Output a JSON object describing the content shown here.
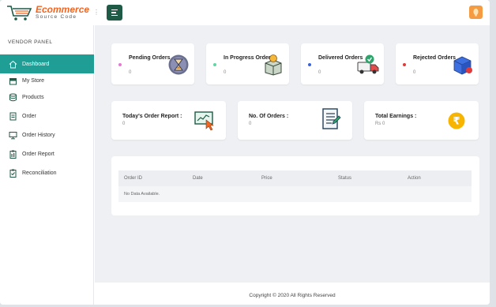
{
  "app": {
    "logo_title": "Ecommerce",
    "logo_subtitle": "Source Code",
    "dots": "⋮"
  },
  "sidebar": {
    "panel_title": "VENDOR PANEL",
    "items": [
      {
        "label": "Dashboard",
        "icon": "home-icon",
        "active": true
      },
      {
        "label": "My Store",
        "icon": "store-icon"
      },
      {
        "label": "Products",
        "icon": "database-icon"
      },
      {
        "label": "Order",
        "icon": "order-icon"
      },
      {
        "label": "Order History",
        "icon": "monitor-icon"
      },
      {
        "label": "Order Report",
        "icon": "report-icon"
      },
      {
        "label": "Reconciliation",
        "icon": "reconciliation-icon"
      }
    ]
  },
  "stats": [
    {
      "title": "Pending Orders",
      "value": "0",
      "dot_color": "#e57ad3",
      "icon": "pending-icon"
    },
    {
      "title": "In Progress Orders",
      "value": "0",
      "dot_color": "#5fd7a0",
      "icon": "package-progress-icon"
    },
    {
      "title": "Delivered Orders",
      "value": "0",
      "dot_color": "#3a63d8",
      "icon": "delivery-truck-icon"
    },
    {
      "title": "Rejected Orders",
      "value": "0",
      "dot_color": "#e03a3a",
      "icon": "rejected-box-icon"
    }
  ],
  "reports": [
    {
      "title": "Today's Order Report :",
      "value": "0",
      "icon": "report-click-icon"
    },
    {
      "title": "No. Of Orders :",
      "value": "0",
      "icon": "order-list-icon"
    },
    {
      "title": "Total Earnings :",
      "value": "Rs 0",
      "icon": "rupee-icon"
    }
  ],
  "table": {
    "columns": [
      "Order ID",
      "Date",
      "Price",
      "Status",
      "Action"
    ],
    "empty_message": "No Data Available."
  },
  "footer": {
    "text": "Copyright © 2020 All Rights Reserved"
  },
  "colors": {
    "brand_orange": "#f26522",
    "primary_green": "#1e5a45",
    "active_teal": "#1f9e95",
    "rupee_yellow": "#f7b500"
  }
}
